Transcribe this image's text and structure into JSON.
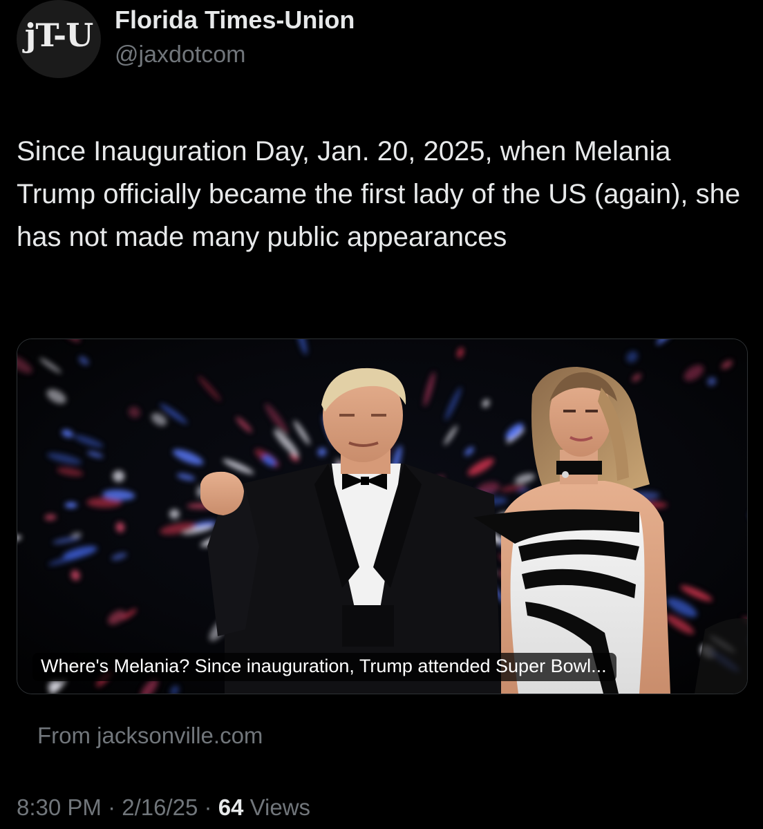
{
  "author": {
    "display_name": "Florida Times-Union",
    "handle": "@jaxdotcom",
    "avatar_text": "jT-U"
  },
  "tweet": {
    "text": "Since Inauguration Day, Jan. 20, 2025, when Melania Trump officially became the first lady of the US (again), she has not made many public appearances"
  },
  "link_card": {
    "title": "Where's Melania? Since inauguration, Trump attended Super Bowl...",
    "source": "From jacksonville.com"
  },
  "meta": {
    "time": "8:30 PM",
    "separator": "·",
    "date": "2/16/25",
    "views_count": "64",
    "views_label": "Views"
  },
  "colors": {
    "background": "#000000",
    "primary_text": "#e7e9ea",
    "secondary_text": "#71767b",
    "card_border": "#2f3336"
  }
}
